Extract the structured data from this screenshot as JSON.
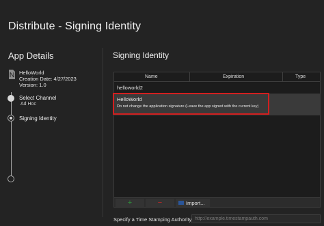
{
  "window": {
    "title": "Distribute - Signing Identity"
  },
  "sidebar": {
    "heading": "App Details",
    "app": {
      "icon": "app-file-icon",
      "name": "HelloWorld",
      "creation_date": "Creation Date: 4/27/2023",
      "version": "Version: 1.0"
    },
    "steps": [
      {
        "label": "Select Channel",
        "sublabel": "Ad Hoc",
        "state": "done"
      },
      {
        "label": "Signing Identity",
        "sublabel": "",
        "state": "active"
      },
      {
        "label": "",
        "sublabel": "",
        "state": "pending"
      }
    ]
  },
  "main": {
    "heading": "Signing Identity",
    "table": {
      "columns": [
        "Name",
        "Expiration",
        "Type"
      ],
      "rows": [
        {
          "name": "helloworld2",
          "description": "",
          "selected": false
        },
        {
          "name": "HelloWorld",
          "description": "Do not change the application signature (Leave the app signed with the current key)",
          "selected": true
        }
      ]
    },
    "toolbar": {
      "add_icon": "plus-icon",
      "add_label": "+",
      "remove_icon": "minus-icon",
      "remove_label": "−",
      "import_label": "Import..."
    },
    "timestamp": {
      "label": "Specify a Time Stamping Authority:",
      "placeholder": "http://example.timestampauth.com",
      "value": ""
    }
  },
  "colors": {
    "background": "#232323",
    "highlight": "#d21f1f",
    "add": "#2f8f3a",
    "remove": "#c62828",
    "selected_row": "#3a3a3a"
  }
}
